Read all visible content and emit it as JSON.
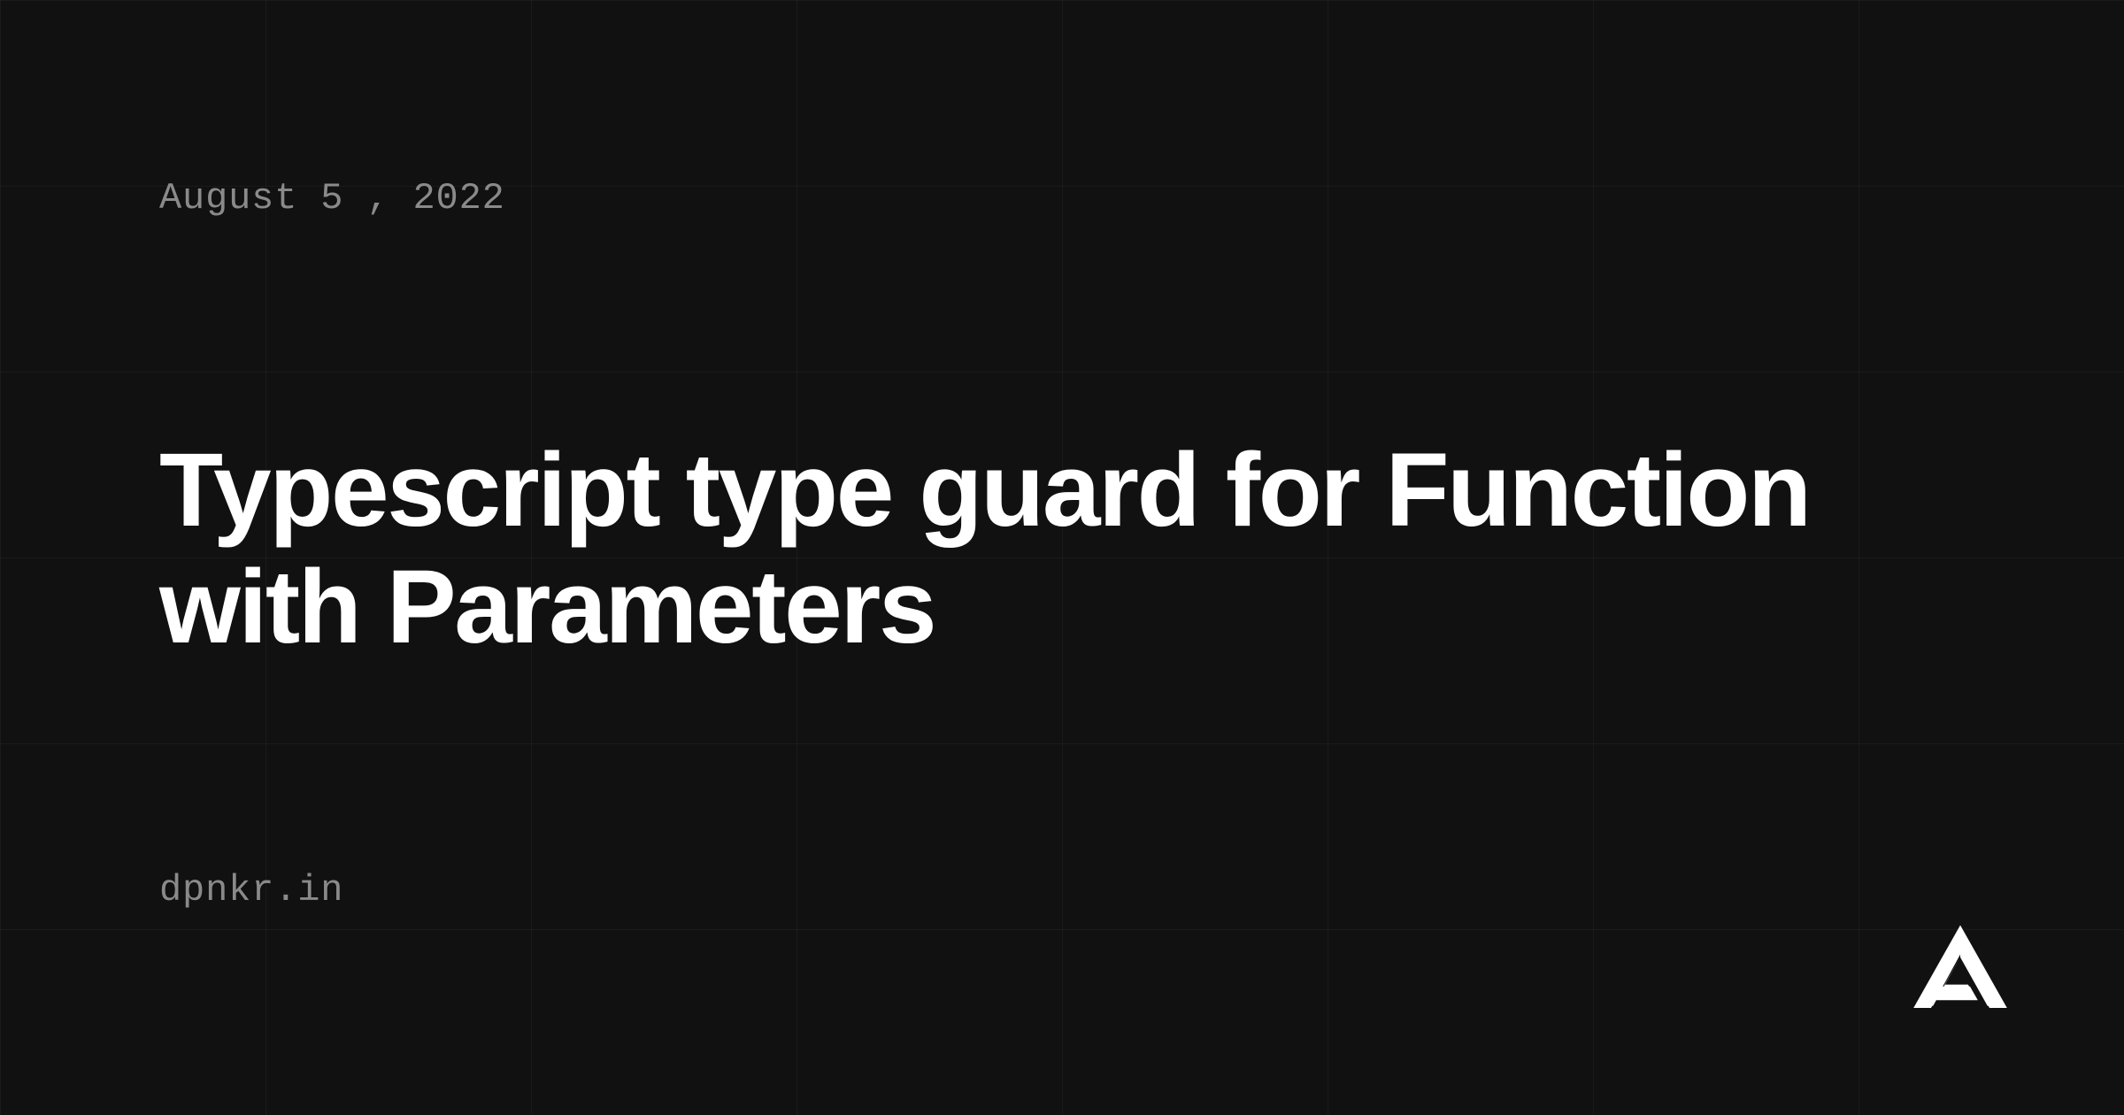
{
  "date": "August 5 , 2022",
  "title": "Typescript type guard for Function with Parameters",
  "domain": "dpnkr.in"
}
